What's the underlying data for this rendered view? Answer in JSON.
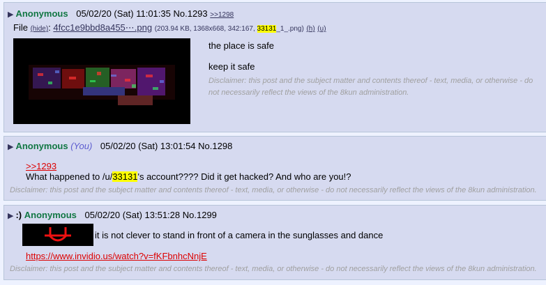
{
  "posts": [
    {
      "prefix": "",
      "name": "Anonymous",
      "you": "",
      "date": "05/02/20 (Sat) 11:01:35",
      "number": "No.1293",
      "backlink": ">>1298",
      "file": {
        "label": "File",
        "hide": "(hide)",
        "colon": ":",
        "filename": "4fcc1e9bbd8a455⋯.png",
        "meta_pre": "(203.94 KB, 1368x668, 342:167, ",
        "meta_hl": "33131",
        "meta_post": "_1_.png)",
        "h": "(h)",
        "u": "(u)"
      },
      "lines": [
        "the place is safe",
        "keep it safe"
      ],
      "disclaimer_lines": [
        "Disclaimer: this post and the subject matter and contents thereof - text, media, or otherwise - do",
        "not necessarily reflect the views of the 8kun administration."
      ]
    },
    {
      "prefix": "",
      "name": "Anonymous",
      "you": "(You)",
      "date": "05/02/20 (Sat) 13:01:54",
      "number": "No.1298",
      "quote": ">>1293",
      "text_pre": "What happened to /u/",
      "text_hl": "33131",
      "text_post": "'s account???? Did it get hacked? And who are you!?",
      "disclaimer": "Disclaimer: this post and the subject matter and contents thereof - text, media, or otherwise - do not necessarily reflect the views of the 8kun administration."
    },
    {
      "prefix": ":)",
      "name": "Anonymous",
      "you": "",
      "date": "05/02/20 (Sat) 13:51:28",
      "number": "No.1299",
      "emoji_text": "⋃",
      "text": "it is not clever to stand in front of a camera in the sunglasses and dance",
      "link": "https://www.invidio.us/watch?v=fKFbnhcNnjE",
      "disclaimer": "Disclaimer: this post and the subject matter and contents thereof - text, media, or otherwise - do not necessarily reflect the views of the 8kun administration."
    }
  ],
  "colors": {
    "post_bg": "#d6daf0",
    "page_bg": "#eef2ff",
    "name": "#117743",
    "quote": "#dd0000",
    "highlight": "#ffff00"
  }
}
